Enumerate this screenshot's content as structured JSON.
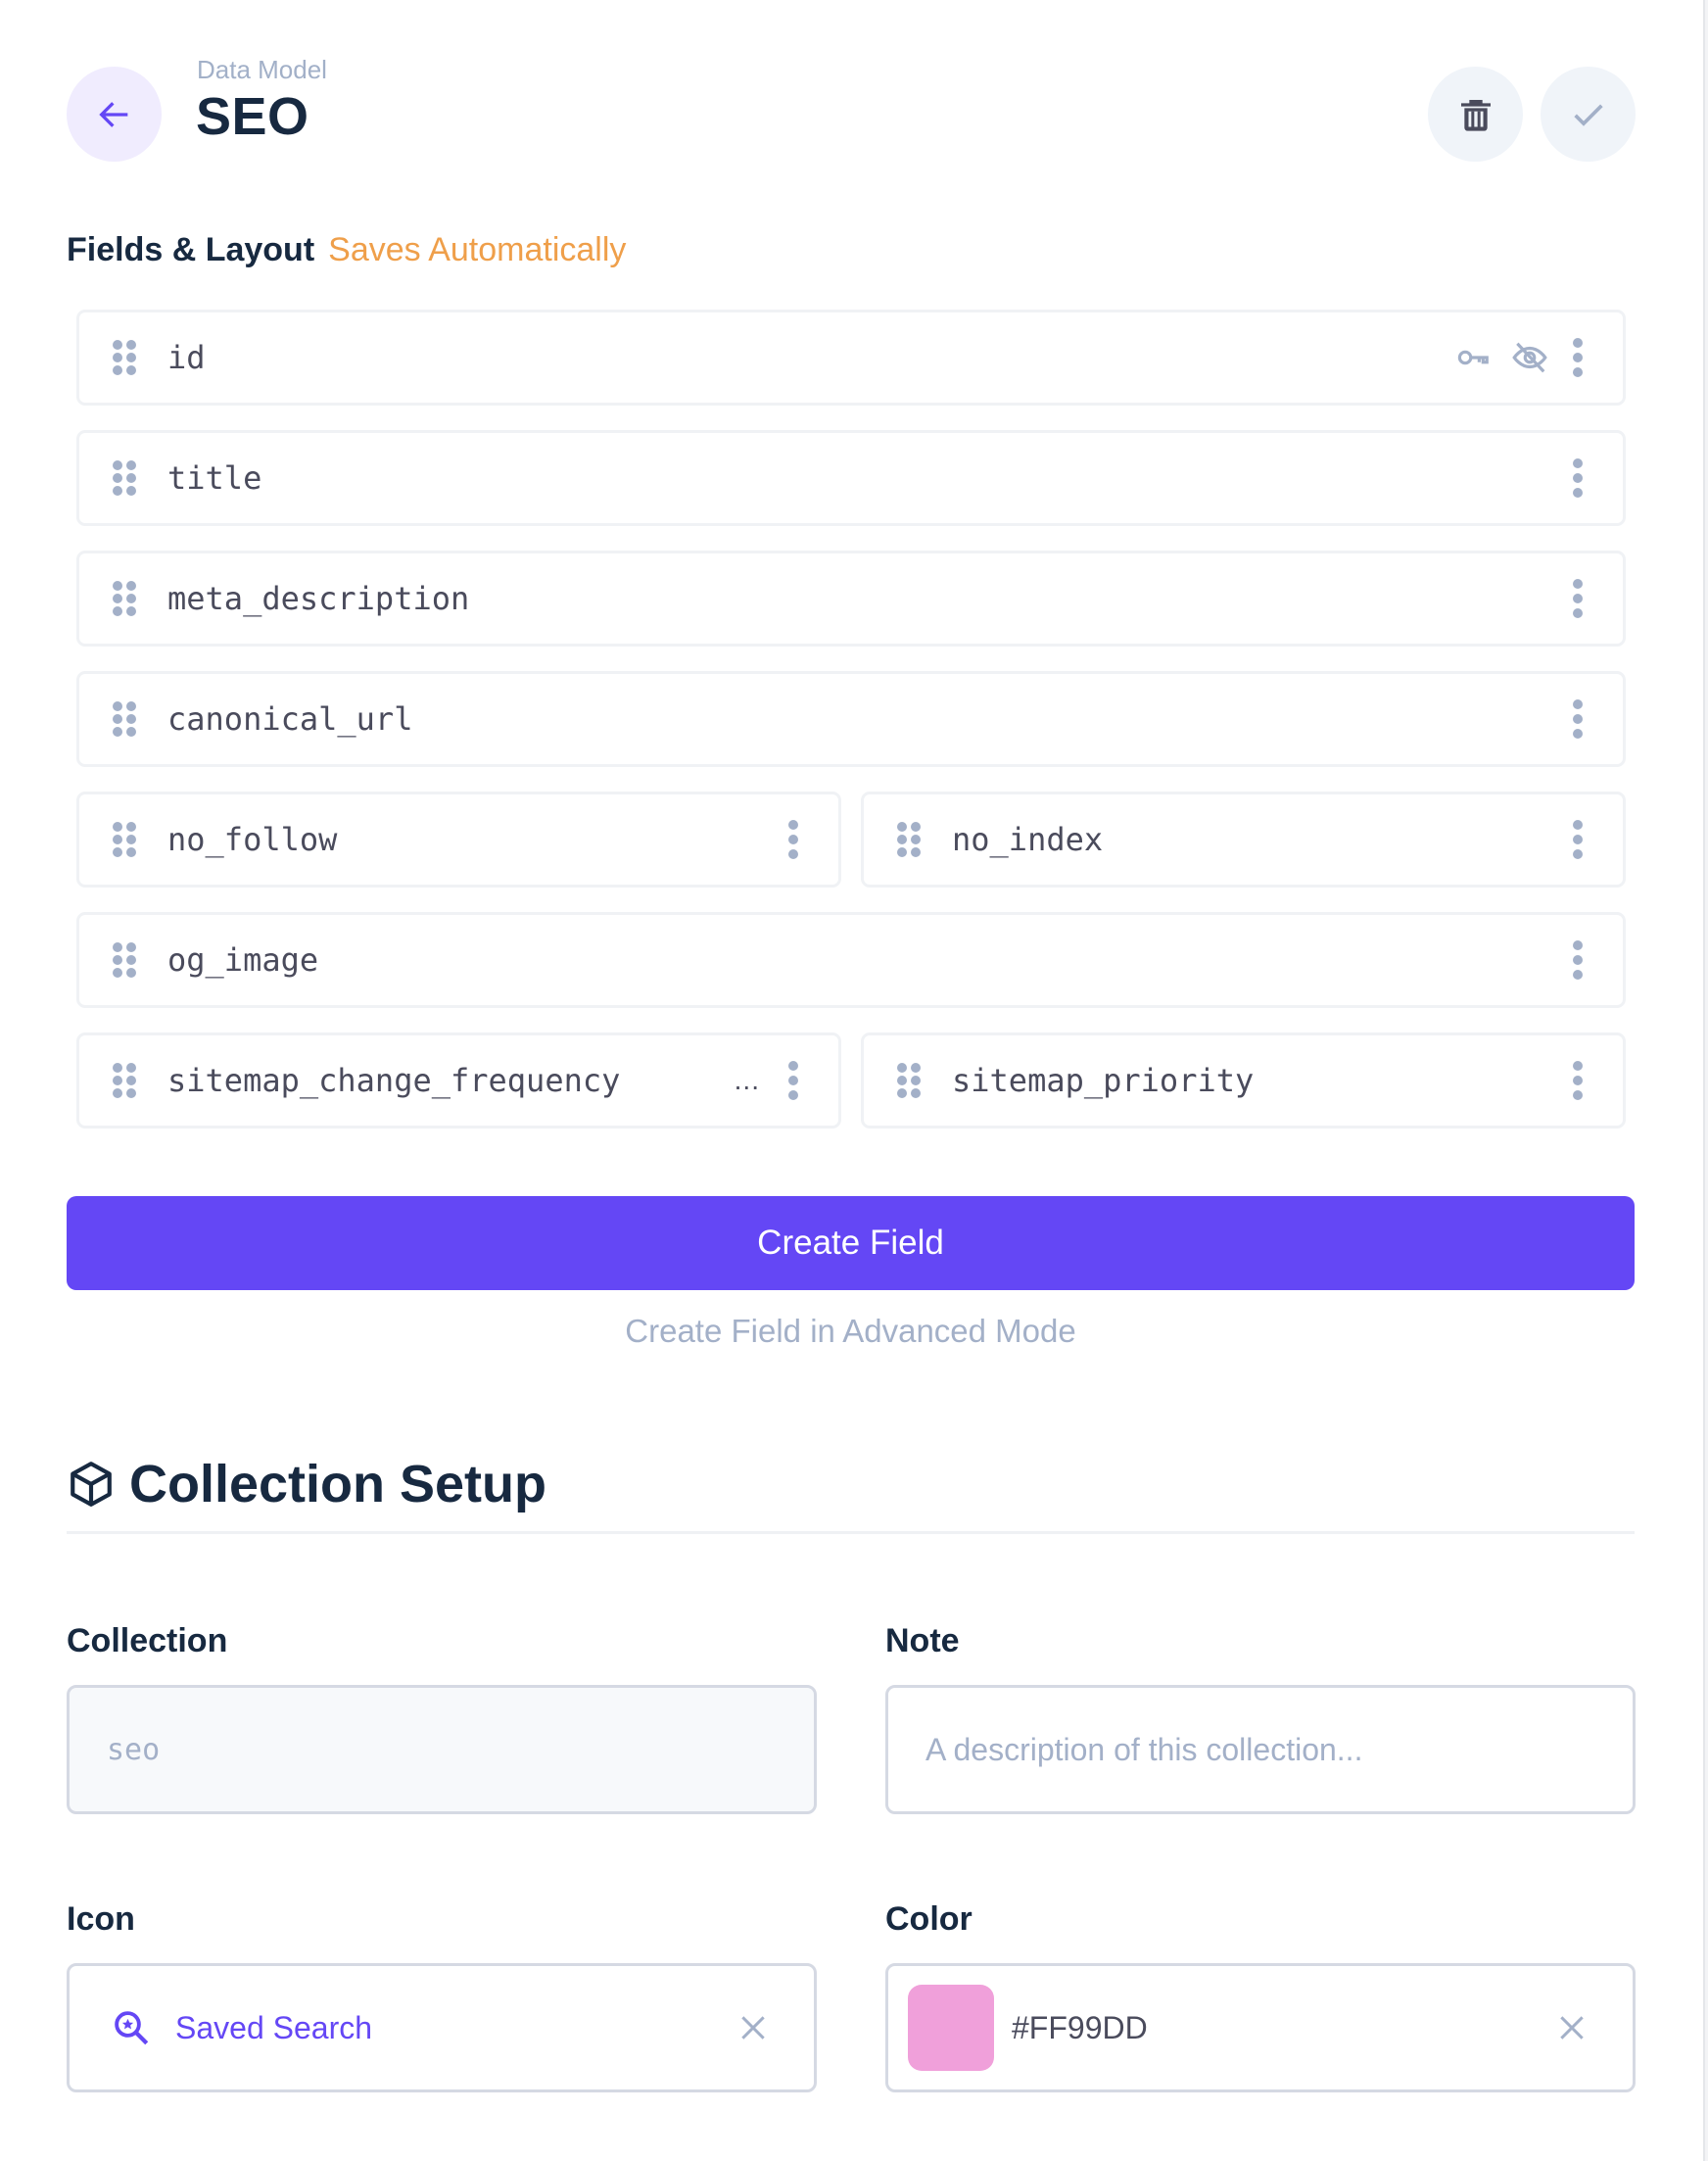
{
  "header": {
    "breadcrumb": "Data Model",
    "title": "SEO",
    "back_icon": "arrow-left-icon",
    "delete_icon": "trash-icon",
    "save_icon": "check-icon"
  },
  "fields_section": {
    "label": "Fields & Layout",
    "status": "Saves Automatically"
  },
  "fields": [
    {
      "name": "id",
      "width": "full",
      "icons": [
        "key-icon",
        "eye-off-icon"
      ]
    },
    {
      "name": "title",
      "width": "full"
    },
    {
      "name": "meta_description",
      "width": "full"
    },
    {
      "name": "canonical_url",
      "width": "full"
    },
    {
      "name": "no_follow",
      "width": "half"
    },
    {
      "name": "no_index",
      "width": "half"
    },
    {
      "name": "og_image",
      "width": "full"
    },
    {
      "name": "sitemap_change_frequency",
      "width": "half",
      "truncated_indicator": "..."
    },
    {
      "name": "sitemap_priority",
      "width": "half"
    }
  ],
  "actions": {
    "create_field": "Create Field",
    "create_advanced": "Create Field in Advanced Mode"
  },
  "setup": {
    "title": "Collection Setup",
    "title_icon": "box-icon",
    "collection": {
      "label": "Collection",
      "value": "seo"
    },
    "note": {
      "label": "Note",
      "placeholder": "A description of this collection..."
    },
    "icon": {
      "label": "Icon",
      "value": "Saved Search",
      "icon": "saved-search-icon"
    },
    "color": {
      "label": "Color",
      "value": "#FF99DD",
      "swatch": "#f0a0da"
    }
  },
  "colors": {
    "accent": "#6447f5",
    "warning": "#ef9f4a",
    "muted": "#a3b0c8",
    "text": "#172940"
  }
}
